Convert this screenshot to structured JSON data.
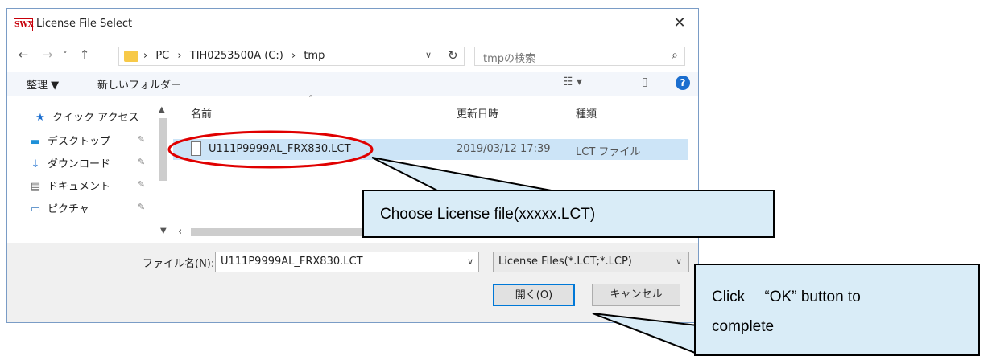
{
  "window": {
    "logo_text": "SWX",
    "title": "License File Select",
    "close_label": "✕"
  },
  "nav": {
    "back": "←",
    "forward": "→",
    "recent": "˅",
    "up": "↑",
    "breadcrumbs": [
      "›",
      "PC",
      "›",
      "TIH0253500A (C:)",
      "›",
      "tmp"
    ],
    "address_dropdown": "∨",
    "refresh": "↻",
    "search_placeholder": "tmpの検索",
    "search_icon": "⌕"
  },
  "toolbar": {
    "organize": "整理 ▼",
    "new_folder": "新しいフォルダー",
    "view_icon": "☷ ▾",
    "pane_icon": "▯",
    "help": "?"
  },
  "sidebar": {
    "items": [
      {
        "icon": "★",
        "label": "クイック アクセス"
      },
      {
        "icon": "▬",
        "label": "デスクトップ"
      },
      {
        "icon": "↓",
        "label": "ダウンロード"
      },
      {
        "icon": "▤",
        "label": "ドキュメント"
      },
      {
        "icon": "▭",
        "label": "ピクチャ"
      }
    ],
    "pin": "✎"
  },
  "list": {
    "columns": [
      "名前",
      "更新日時",
      "種類"
    ],
    "rows": [
      {
        "name": "U111P9999AL_FRX830.LCT",
        "date": "2019/03/12 17:39",
        "type": "LCT ファイル"
      }
    ]
  },
  "footer": {
    "filename_label": "ファイル名(N):",
    "filename_value": "U111P9999AL_FRX830.LCT",
    "filetype_value": "License Files(*.LCT;*.LCP)",
    "open_label": "開く(O)",
    "cancel_label": "キャンセル"
  },
  "callouts": {
    "choose": "Choose License file(xxxxx.LCT)",
    "click_line1": "Click 　“OK” button to",
    "click_line2": "complete"
  },
  "colors": {
    "selection": "#cce4f7",
    "callout_bg": "#d9ecf7",
    "highlight_ellipse": "#e00000",
    "focus_border": "#0078d7"
  }
}
